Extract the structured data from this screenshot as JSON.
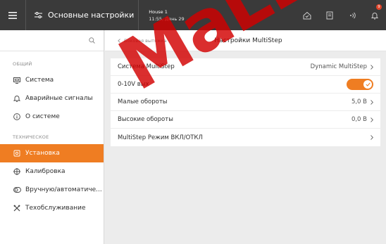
{
  "topbar": {
    "title": "Основные настройки",
    "site_name": "House 1",
    "site_time": "11:55, День 29",
    "notification_count": "9",
    "accent": "#ef7d22"
  },
  "sidebar": {
    "group_general": "ОБЩИЙ",
    "general_items": [
      {
        "label": "Система",
        "icon": "monitor-icon"
      },
      {
        "label": "Аварийные сигналы",
        "icon": "bell-icon"
      },
      {
        "label": "О системе",
        "icon": "info-icon"
      }
    ],
    "group_tech": "ТЕХНИЧЕСКОЕ",
    "tech_items": [
      {
        "label": "Установка",
        "icon": "gear-icon",
        "active": true
      },
      {
        "label": "Калибровка",
        "icon": "crosshair-icon"
      },
      {
        "label": "Вручную/автоматиче...",
        "icon": "toggle-icon"
      },
      {
        "label": "Техобслуживание",
        "icon": "tools-icon"
      }
    ]
  },
  "main": {
    "back_label": "Боковая вытяжка",
    "page_title": "Настройки MultiStep",
    "rows": [
      {
        "label": "Система MultiStep",
        "value": "Dynamic MultiStep"
      },
      {
        "label": "0-10V вых",
        "value": ""
      },
      {
        "label": "Малые обороты",
        "value": "5,0 В"
      },
      {
        "label": "Высокие обороты",
        "value": "0,0 В"
      },
      {
        "label": "MultiStep Режим ВКЛ/ОТКЛ",
        "value": ""
      }
    ],
    "toggle_on": true
  },
  "watermark": "MaLLW"
}
